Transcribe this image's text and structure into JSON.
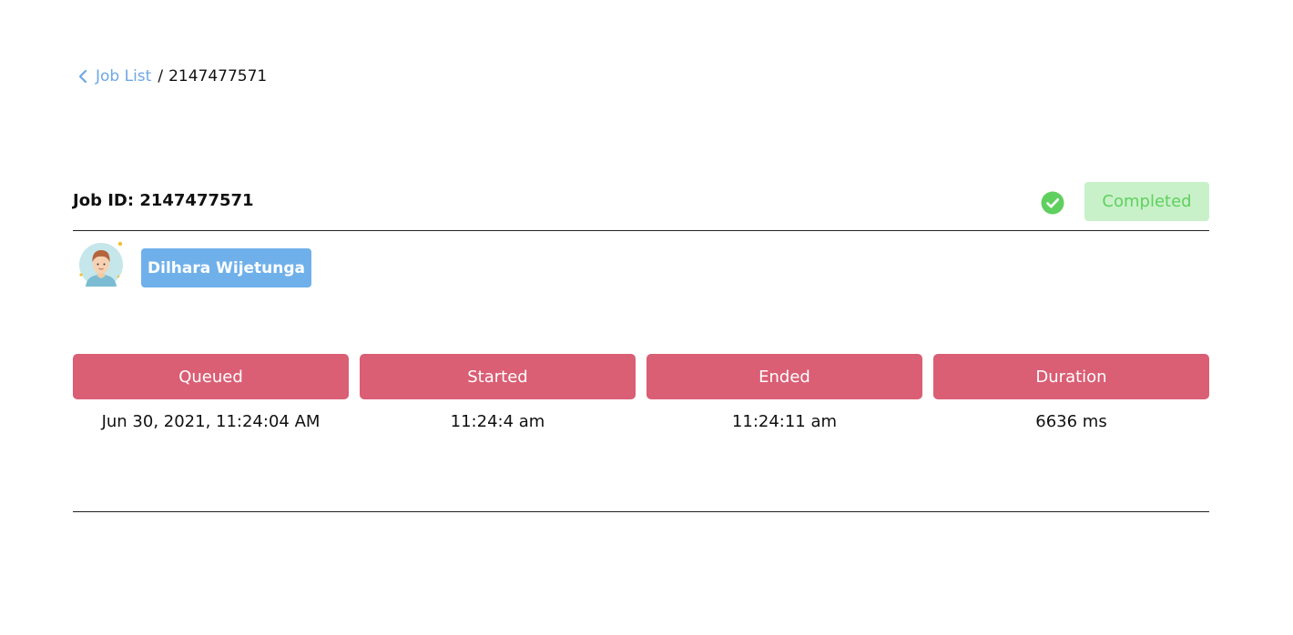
{
  "breadcrumb": {
    "back_label": "Job List",
    "separator": "/",
    "current": "2147477571",
    "back_icon": "chevron-left-icon"
  },
  "job": {
    "id_label": "Job ID: 2147477571",
    "status": "Completed",
    "status_icon": "check-circle-icon",
    "user_name": "Dilhara Wijetunga",
    "avatar_icon": "user-avatar"
  },
  "timing": {
    "columns": [
      {
        "label": "Queued",
        "value": "Jun 30, 2021, 11:24:04 AM"
      },
      {
        "label": "Started",
        "value": "11:24:4 am"
      },
      {
        "label": "Ended",
        "value": "11:24:11 am"
      },
      {
        "label": "Duration",
        "value": "6636 ms"
      }
    ]
  },
  "colors": {
    "link": "#6fa8e6",
    "status_bg": "#c9f1c9",
    "status_text": "#5fd05f",
    "user_chip": "#6fb0ea",
    "header_cell": "#da5e74"
  }
}
